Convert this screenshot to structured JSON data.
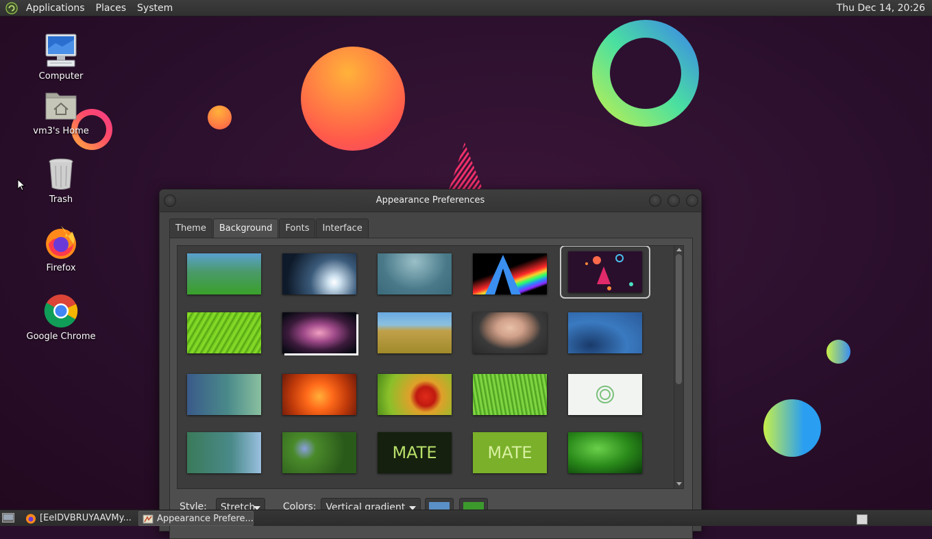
{
  "top_panel": {
    "menus": [
      "Applications",
      "Places",
      "System"
    ],
    "clock": "Thu Dec 14, 20:26"
  },
  "desktop": {
    "icons": [
      {
        "label": "Computer",
        "icon": "computer-icon"
      },
      {
        "label": "vm3's Home",
        "icon": "home-folder-icon"
      },
      {
        "label": "Trash",
        "icon": "trash-icon"
      },
      {
        "label": "Firefox",
        "icon": "firefox-icon"
      },
      {
        "label": "Google Chrome",
        "icon": "chrome-icon"
      }
    ]
  },
  "window": {
    "title": "Appearance Preferences",
    "tabs": [
      "Theme",
      "Background",
      "Fonts",
      "Interface"
    ],
    "active_tab": "Background",
    "style_label": "Style:",
    "style_value": "Stretch",
    "colors_label": "Colors:",
    "colors_value": "Vertical gradient",
    "primary_color": "#5a8fc7",
    "secondary_color": "#3c9a2c",
    "selected_wallpaper_index": 4,
    "mate_text": "MATE"
  },
  "taskbar": {
    "tasks": [
      {
        "label": "[EeIDVBRUYAAVMy...",
        "icon": "firefox-icon",
        "active": false
      },
      {
        "label": "Appearance Prefere...",
        "icon": "appearance-icon",
        "active": true
      }
    ]
  },
  "colors": {
    "panel_bg": "#333333",
    "desktop_bg": "#2a0f2c",
    "window_bg": "#4e4e4e"
  }
}
